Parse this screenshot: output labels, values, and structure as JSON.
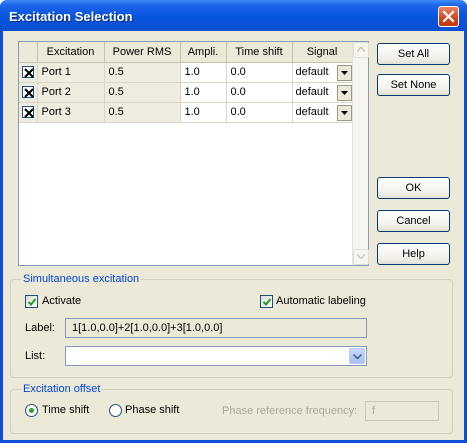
{
  "window": {
    "title": "Excitation Selection"
  },
  "grid": {
    "columns": [
      "",
      "Excitation",
      "Power RMS",
      "Ampli.",
      "Time shift",
      "Signal"
    ],
    "rows": [
      {
        "checked": true,
        "excitation": "Port 1",
        "power": "0.5",
        "ampli": "1.0",
        "time_shift": "0.0",
        "signal": "default"
      },
      {
        "checked": true,
        "excitation": "Port 2",
        "power": "0.5",
        "ampli": "1.0",
        "time_shift": "0.0",
        "signal": "default"
      },
      {
        "checked": true,
        "excitation": "Port 3",
        "power": "0.5",
        "ampli": "1.0",
        "time_shift": "0.0",
        "signal": "default"
      }
    ]
  },
  "buttons": {
    "set_all": "Set All",
    "set_none": "Set None",
    "ok": "OK",
    "cancel": "Cancel",
    "help": "Help"
  },
  "simultaneous": {
    "title": "Simultaneous excitation",
    "activate_label": "Activate",
    "activate_checked": true,
    "auto_label": "Automatic labeling",
    "auto_checked": true,
    "label_caption": "Label:",
    "label_value": "1[1.0,0.0]+2[1.0,0.0]+3[1.0,0.0]",
    "list_caption": "List:",
    "list_value": ""
  },
  "offset": {
    "title": "Excitation offset",
    "time_shift_label": "Time shift",
    "time_shift_selected": true,
    "phase_shift_label": "Phase shift",
    "phase_ref_label": "Phase reference frequency:",
    "phase_ref_value": "f"
  },
  "icons": {
    "close": "close-icon",
    "dropdown": "chevron-down-icon",
    "scroll_up": "scroll-up-icon",
    "scroll_down": "scroll-down-icon",
    "check": "check-icon"
  },
  "colors": {
    "title_bar": "#0a4fd6",
    "dialog_bg": "#ece9d8",
    "group_title": "#0046d5",
    "radio_dot": "#2fa02f"
  }
}
